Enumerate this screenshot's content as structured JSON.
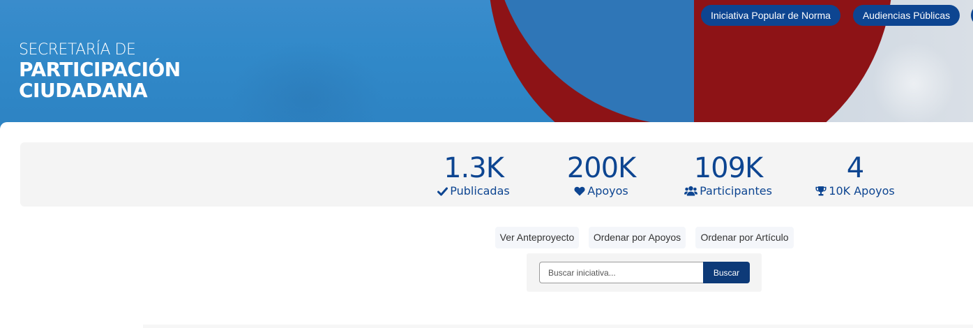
{
  "header": {
    "brand": {
      "line1": "SECRETARÍA DE",
      "line2": "PARTICIPACIÓN",
      "line3": "CIUDADANA"
    },
    "nav": [
      {
        "label": "Iniciativa Popular de Norma"
      },
      {
        "label": "Audiencias Públicas"
      }
    ]
  },
  "stats": [
    {
      "value": "1.3K",
      "label": "Publicadas",
      "icon": "check-icon"
    },
    {
      "value": "200K",
      "label": "Apoyos",
      "icon": "heart-icon"
    },
    {
      "value": "109K",
      "label": "Participantes",
      "icon": "users-icon"
    },
    {
      "value": "4",
      "label": "10K Apoyos",
      "icon": "trophy-icon"
    }
  ],
  "toolbar": {
    "ver_anteproyecto": "Ver Anteproyecto",
    "ordenar_apoyos": "Ordenar por Apoyos",
    "ordenar_articulo": "Ordenar por Artículo"
  },
  "search": {
    "placeholder": "Buscar iniciativa...",
    "value": "",
    "button_label": "Buscar"
  },
  "colors": {
    "primary": "#0d4591",
    "search_button": "#0d3a78",
    "hero_blue": "#3189c9",
    "hero_red": "#8d1316",
    "stats_bg": "#f4f4f4"
  }
}
